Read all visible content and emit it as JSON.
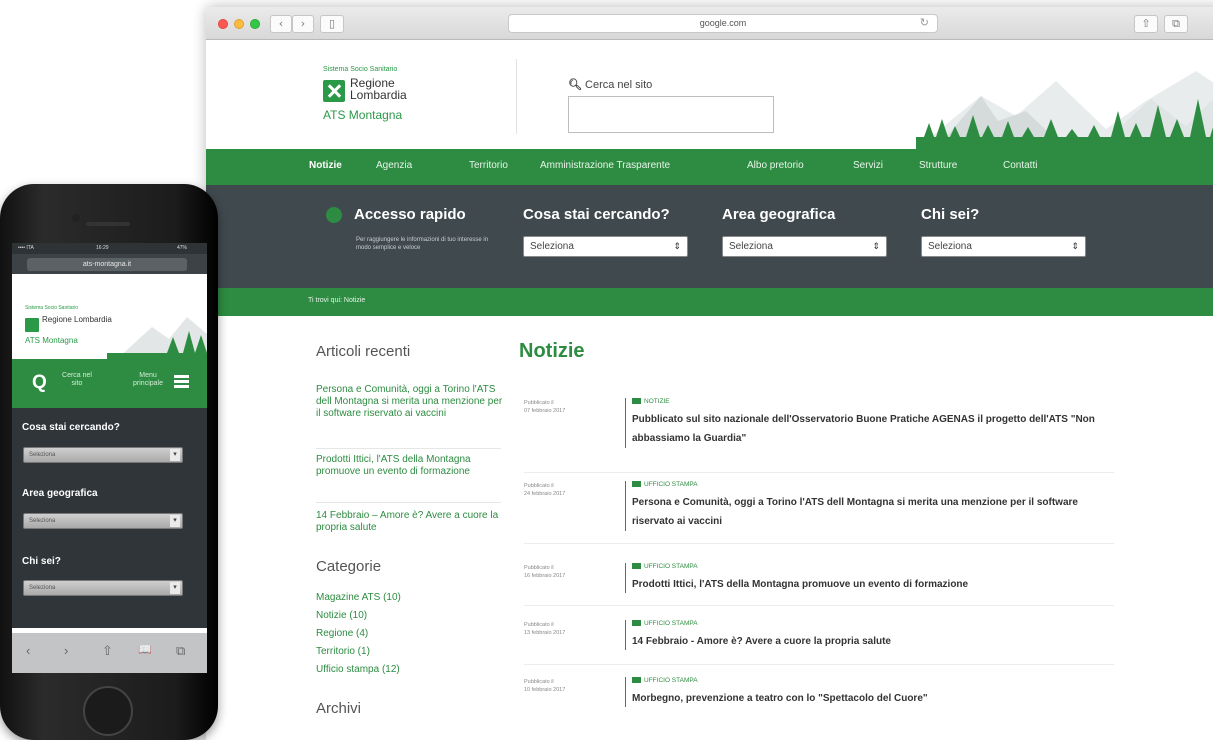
{
  "browser": {
    "url": "google.com",
    "back_glyph": "‹",
    "forward_glyph": "›",
    "sidebar_glyph": "▯",
    "reload_glyph": "↻",
    "share_glyph": "⇧",
    "tabs_glyph": "⧉"
  },
  "site": {
    "logo_small": "Sistema Socio Sanitario",
    "logo_name": "Regione Lombardia",
    "logo_sub": "ATS Montagna",
    "search_label": "Cerca nel sito",
    "search_icon": "search-icon",
    "nav": [
      "Notizie",
      "Agenzia",
      "Territorio",
      "Amministrazione Trasparente",
      "Albo pretorio",
      "Servizi",
      "Strutture",
      "Contatti"
    ],
    "quick": {
      "title": "Accesso rapido",
      "desc": "Per raggiungere le informazioni di tuo interesse in modo semplice e veloce",
      "columns": [
        {
          "title": "Cosa stai cercando?",
          "select": "Seleziona"
        },
        {
          "title": "Area geografica",
          "select": "Seleziona"
        },
        {
          "title": "Chi sei?",
          "select": "Seleziona"
        }
      ],
      "select_arrow": "⇕"
    },
    "breadcrumb": "Ti trovi qui: Notizie",
    "sidebar": {
      "recent_heading": "Articoli recenti",
      "recent": [
        "Persona e Comunità, oggi a Torino l'ATS dell Montagna si merita una menzione per il software riservato ai vaccini",
        "Prodotti Ittici, l'ATS della Montagna promuove un evento di formazione",
        "14 Febbraio – Amore è? Avere a cuore la propria salute"
      ],
      "categories_heading": "Categorie",
      "categories": [
        "Magazine ATS (10)",
        "Notizie (10)",
        "Regione (4)",
        "Territorio (1)",
        "Ufficio stampa (12)"
      ],
      "archive_heading": "Archivi"
    },
    "news_heading": "Notizie",
    "news": [
      {
        "published": "Pubblicato il",
        "date": "07 febbraio 2017",
        "tag": "NOTIZIE",
        "title": "Pubblicato sul sito nazionale dell'Osservatorio Buone Pratiche AGENAS il progetto dell'ATS \"Non abbassiamo la Guardia\""
      },
      {
        "published": "Pubblicato il",
        "date": "24 febbraio 2017",
        "tag": "UFFICIO STAMPA",
        "title": "Persona e Comunità, oggi a Torino l'ATS dell Montagna si merita una menzione per il software riservato ai vaccini"
      },
      {
        "published": "Pubblicato il",
        "date": "16 febbraio 2017",
        "tag": "UFFICIO STAMPA",
        "title": "Prodotti Ittici, l'ATS della Montagna promuove un evento di formazione"
      },
      {
        "published": "Pubblicato il",
        "date": "13 febbraio 2017",
        "tag": "UFFICIO STAMPA",
        "title": "14 Febbraio - Amore è? Avere a cuore la propria salute"
      },
      {
        "published": "Pubblicato il",
        "date": "10 febbraio 2017",
        "tag": "UFFICIO STAMPA",
        "title": "Morbegno, prevenzione a teatro con lo \"Spettacolo del Cuore\""
      }
    ]
  },
  "phone": {
    "status_left": "•••• ITA ",
    "status_time": "16:29",
    "status_right": "47%",
    "url": "ats-montagna.it",
    "logo_small": "Sistema Socio Sanitario",
    "logo_name": "Regione Lombardia",
    "logo_sub": "ATS Montagna",
    "search_glyph": "Q",
    "search_label": "Cerca nel sito",
    "menu_label": "Menu principale",
    "questions": [
      "Cosa stai cercando?",
      "Area geografica",
      "Chi sei?"
    ],
    "select": "Seleziona",
    "select_arrow": "▾",
    "toolbar": [
      "‹",
      "›",
      "⇧",
      "📖",
      "⧉"
    ]
  },
  "colors": {
    "brand_green": "#2d8c41",
    "dark_panel": "#40494e"
  }
}
